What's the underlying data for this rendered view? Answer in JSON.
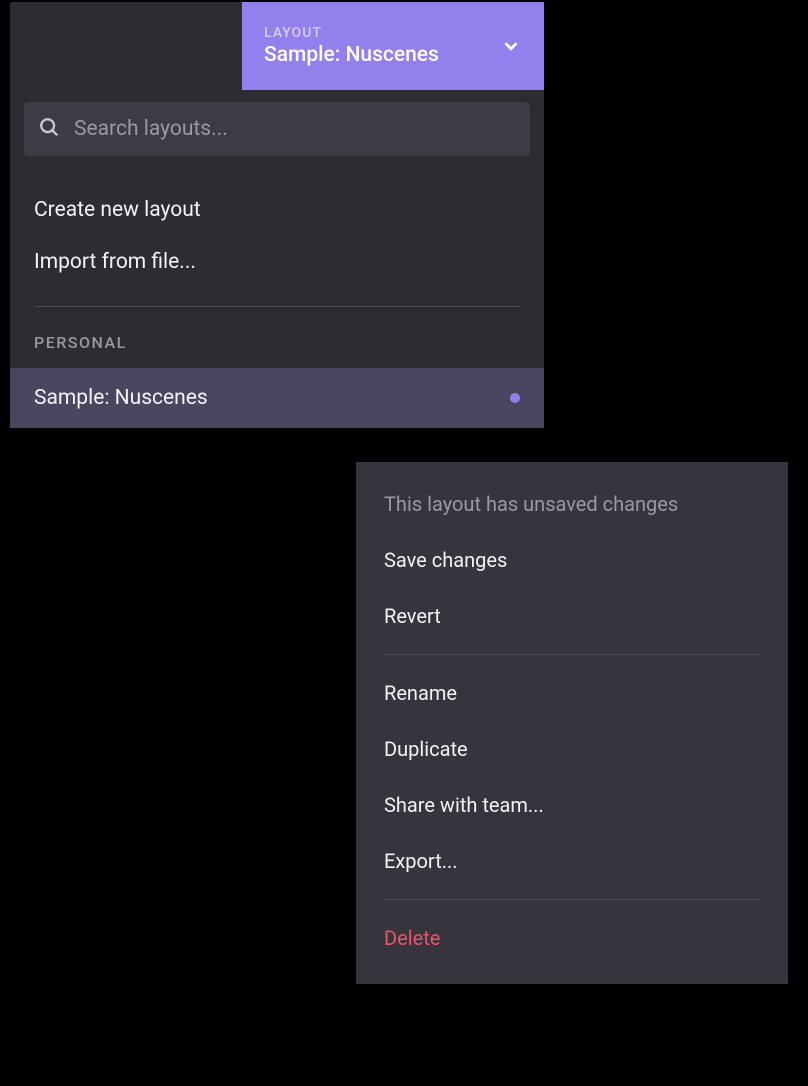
{
  "header": {
    "label": "LAYOUT",
    "value": "Sample: Nuscenes"
  },
  "search": {
    "placeholder": "Search layouts..."
  },
  "actions": {
    "create": "Create new layout",
    "import": "Import from file..."
  },
  "section_label": "PERSONAL",
  "layouts": [
    {
      "name": "Sample: Nuscenes",
      "unsaved": true
    }
  ],
  "context_menu": {
    "note": "This layout has unsaved changes",
    "save": "Save changes",
    "revert": "Revert",
    "rename": "Rename",
    "duplicate": "Duplicate",
    "share": "Share with team...",
    "export": "Export...",
    "delete": "Delete"
  }
}
